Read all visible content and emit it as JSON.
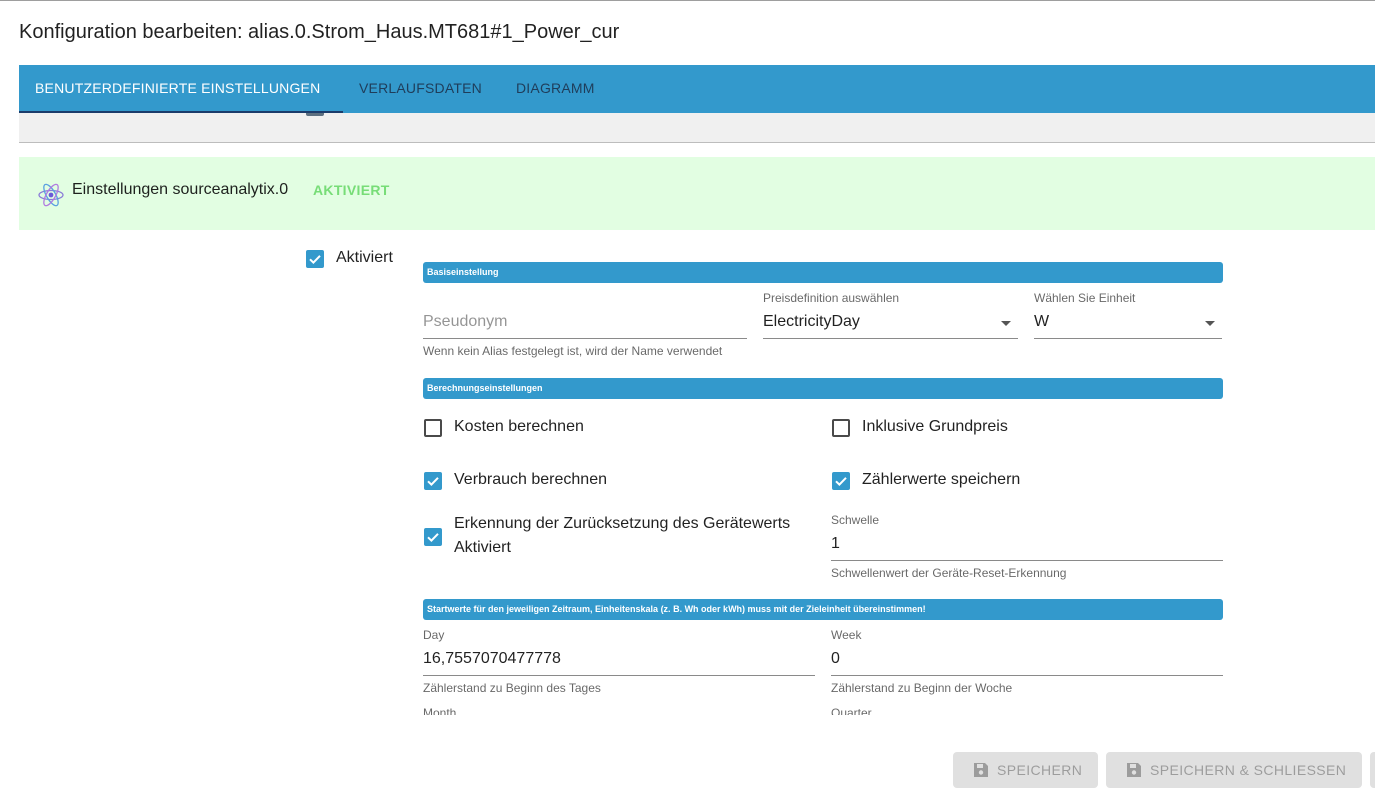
{
  "dialog": {
    "title": "Konfiguration bearbeiten: alias.0.Strom_Haus.MT681#1_Power_cur"
  },
  "tabs": [
    {
      "label": "BENUTZERDEFINIERTE EINSTELLUNGEN",
      "active": true
    },
    {
      "label": "VERLAUFSDATEN",
      "active": false
    },
    {
      "label": "DIAGRAMM",
      "active": false
    }
  ],
  "banner": {
    "icon": "atom-icon",
    "title": "Einstellungen sourceanalytix.0",
    "status": "AKTIVIERT"
  },
  "enabled": {
    "label": "Aktiviert",
    "checked": true
  },
  "sections": {
    "base": "Basiseinstellung",
    "calc": "Berechnungseinstellungen",
    "start": "Startwerte für den jeweiligen Zeitraum, Einheitenskala (z. B. Wh oder kWh) muss mit der Zieleinheit übereinstimmen!"
  },
  "fields": {
    "alias": {
      "placeholder": "Pseudonym",
      "value": "",
      "help": "Wenn kein Alias festgelegt ist, wird der Name verwendet"
    },
    "price": {
      "label": "Preisdefinition auswählen",
      "value": "ElectricityDay"
    },
    "unit": {
      "label": "Wählen Sie Einheit",
      "value": "W"
    },
    "threshold": {
      "label": "Schwelle",
      "value": "1",
      "help": "Schwellenwert der Geräte-Reset-Erkennung"
    },
    "day": {
      "label": "Day",
      "value": "16,7557070477778",
      "help": "Zählerstand zu Beginn des Tages"
    },
    "week": {
      "label": "Week",
      "value": "0",
      "help": "Zählerstand zu Beginn der Woche"
    },
    "month": {
      "label": "Month"
    },
    "quarter": {
      "label": "Quarter"
    }
  },
  "checkboxes": {
    "costs": {
      "label": "Kosten berechnen",
      "checked": false
    },
    "basic_price": {
      "label": "Inklusive Grundpreis",
      "checked": false
    },
    "consumption": {
      "label": "Verbrauch berechnen",
      "checked": true
    },
    "meter_values": {
      "label": "Zählerwerte speichern",
      "checked": true
    },
    "reset_detection": {
      "label_line1": "Erkennung der Zurücksetzung des Gerätewerts",
      "label_line2": "Aktiviert",
      "checked": true
    }
  },
  "buttons": {
    "save": "SPEICHERN",
    "save_close": "SPEICHERN & SCHLIESSEN"
  },
  "colors": {
    "primary": "#3399cc",
    "banner_bg": "#e2fee2",
    "status_green": "#77dd77",
    "tab_indicator": "#1b3c6b"
  }
}
